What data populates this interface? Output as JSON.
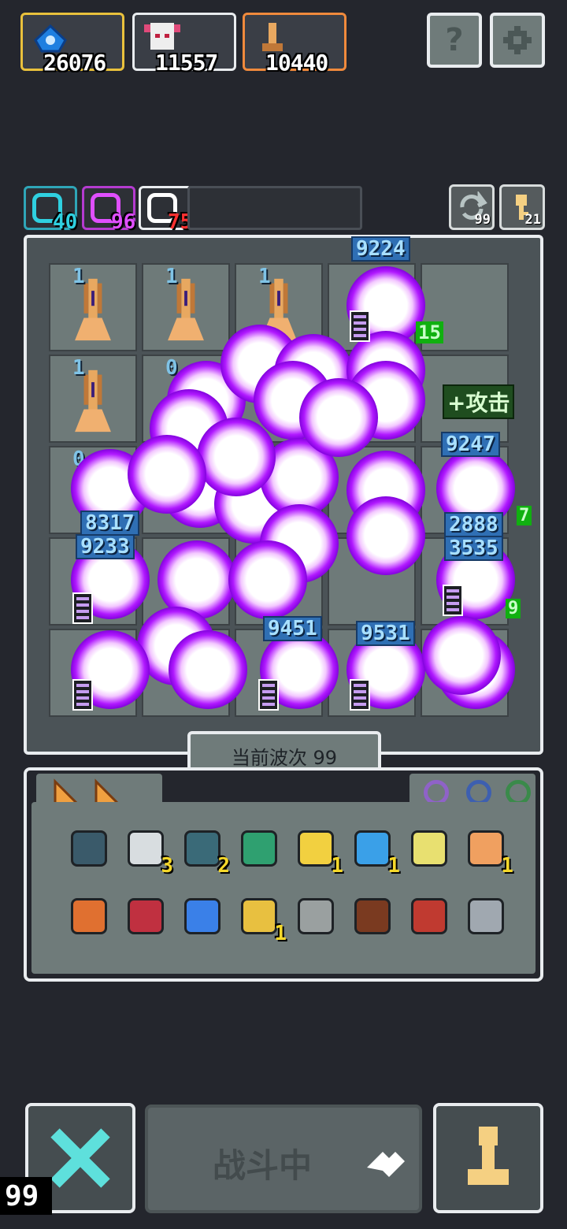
{
  "resources": [
    {
      "name": "blue-gem",
      "value": "26076",
      "border": "#e9c13c"
    },
    {
      "name": "character-portrait",
      "value": "11557",
      "border": "#e9ecef"
    },
    {
      "name": "wood-tower",
      "value": "10440",
      "border": "#f08a3c"
    }
  ],
  "top_buttons": {
    "help": "?"
  },
  "buffs": [
    {
      "count": "40",
      "color": "#2fd0e0"
    },
    {
      "count": "96",
      "color": "#e04fff"
    },
    {
      "count": "75",
      "color": "#ff3030"
    }
  ],
  "utility": {
    "refresh_count": "99",
    "key_count": "21"
  },
  "board": {
    "tower_levels": [
      "1",
      "1",
      "1",
      "1",
      "0",
      "0",
      "0"
    ],
    "damage_numbers": [
      "9224",
      "9247",
      "8317",
      "9233",
      "2888",
      "3535",
      "9451",
      "9531",
      "15",
      "7",
      "9"
    ],
    "buff_label": "+攻击",
    "wave_label": "当前波次 99"
  },
  "inventory": {
    "row1": [
      {
        "icon": "safe-icon",
        "qty": ""
      },
      {
        "icon": "scroll-icon",
        "qty": "3"
      },
      {
        "icon": "heart-shield-icon",
        "qty": "2"
      },
      {
        "icon": "jar-icon",
        "qty": ""
      },
      {
        "icon": "chip-icon",
        "qty": "1"
      },
      {
        "icon": "water-drop-icon",
        "qty": "1"
      },
      {
        "icon": "potion-icon",
        "qty": ""
      },
      {
        "icon": "bust-icon",
        "qty": "1"
      }
    ],
    "row2": [
      {
        "icon": "diamond-icon",
        "qty": ""
      },
      {
        "icon": "flower-icon",
        "qty": ""
      },
      {
        "icon": "orb-icon",
        "qty": ""
      },
      {
        "icon": "shield-icon",
        "qty": "1"
      },
      {
        "icon": "camera-icon",
        "qty": ""
      },
      {
        "icon": "log-icon",
        "qty": ""
      },
      {
        "icon": "maple-leaf-icon",
        "qty": ""
      },
      {
        "icon": "dice-icon",
        "qty": ""
      }
    ]
  },
  "bottom": {
    "battle_label": "战斗中",
    "corner_count": "99"
  },
  "colors": {
    "accent_purple": "#b018ff",
    "accent_cyan": "#5ee0dc",
    "gold": "#f5d082"
  }
}
